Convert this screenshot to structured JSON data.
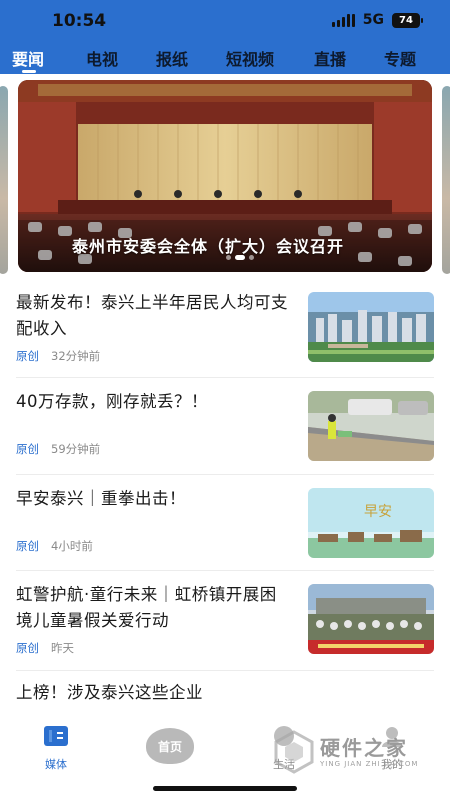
{
  "status_bar": {
    "time": "10:54",
    "network": "5G",
    "battery": "74"
  },
  "top_nav": {
    "tabs": [
      {
        "label": "要闻"
      },
      {
        "label": "电视"
      },
      {
        "label": "报纸"
      },
      {
        "label": "短视频"
      },
      {
        "label": "直播"
      },
      {
        "label": "专题"
      }
    ]
  },
  "carousel": {
    "caption": "泰州市安委会全体（扩大）会议召开"
  },
  "news": [
    {
      "title": "最新发布！泰兴上半年居民人均可支配收入",
      "source": "原创",
      "time": "32分钟前"
    },
    {
      "title": "40万存款，刚存就丢？！",
      "source": "原创",
      "time": "59分钟前"
    },
    {
      "title": "早安泰兴｜重拳出击！",
      "source": "原创",
      "time": "4小时前"
    },
    {
      "title": "虹警护航·童行未来｜虹桥镇开展困境儿童暑假关爱行动",
      "source": "原创",
      "time": "昨天"
    },
    {
      "title": "上榜！涉及泰兴这些企业"
    }
  ],
  "thumb_text": {
    "greeting": "早安"
  },
  "bottom_bar": {
    "tabs": [
      {
        "label": "媒体"
      },
      {
        "label": "首页"
      },
      {
        "label": "生活"
      },
      {
        "label": "我的"
      }
    ]
  },
  "watermark": {
    "text": "硬件之家",
    "sub": "YING JIAN ZHI JIA.COM"
  },
  "colors": {
    "accent": "#2b6fce",
    "meta_gray": "#8a8a8a"
  }
}
